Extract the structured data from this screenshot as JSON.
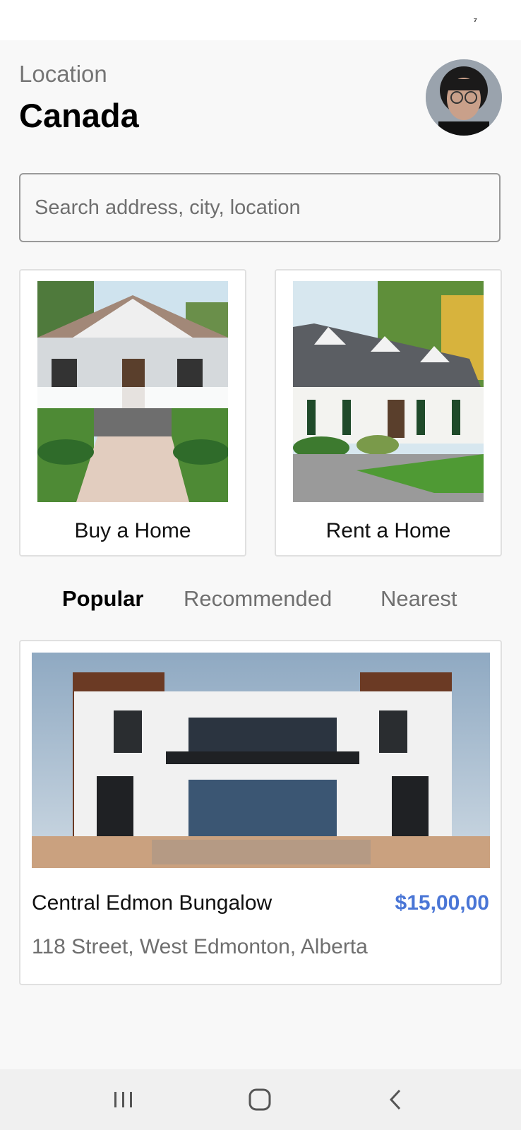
{
  "status_bar": {
    "glyph": "⁷"
  },
  "header": {
    "location_label": "Location",
    "location_value": "Canada",
    "avatar_icon": "profile-photo"
  },
  "search": {
    "placeholder": "Search address, city, location",
    "value": ""
  },
  "categories": [
    {
      "label": "Buy a Home",
      "image": "house-porch-photo"
    },
    {
      "label": "Rent a Home",
      "image": "house-dormers-photo"
    }
  ],
  "tabs": [
    {
      "label": "Popular",
      "active": true
    },
    {
      "label": "Recommended",
      "active": false
    },
    {
      "label": "Nearest",
      "active": false
    }
  ],
  "listing": {
    "title": "Central Edmon Bungalow",
    "price": "$15,00,00",
    "address": "118 Street, West Edmonton, Alberta",
    "image": "modern-house-photo"
  },
  "nav": {
    "recents_icon": "recents-icon",
    "home_icon": "home-icon",
    "back_icon": "back-icon"
  },
  "colors": {
    "accent_price": "#4a76d6",
    "background": "#f8f8f8"
  }
}
